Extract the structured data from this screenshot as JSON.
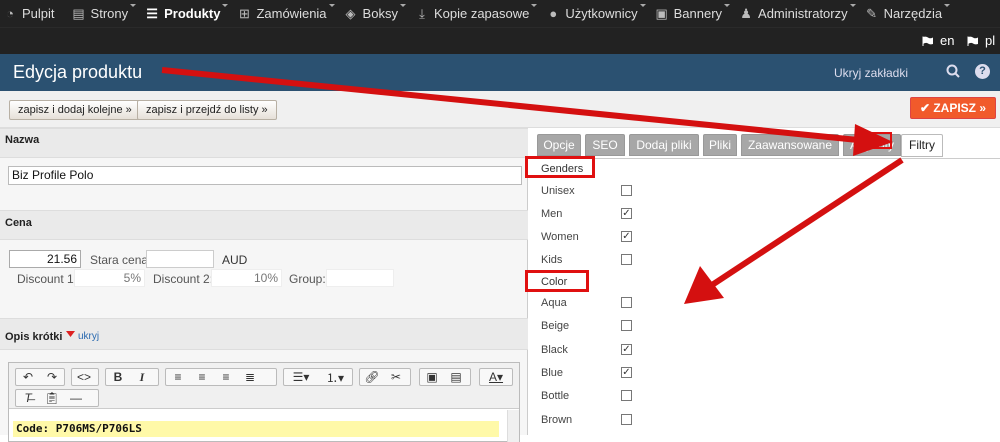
{
  "topnav": {
    "items": [
      {
        "label": "Pulpit",
        "icon": "gauge-icon",
        "active": false,
        "caret": false
      },
      {
        "label": "Strony",
        "icon": "page-icon",
        "active": false,
        "caret": true
      },
      {
        "label": "Produkty",
        "icon": "list-icon",
        "active": true,
        "caret": true
      },
      {
        "label": "Zamówienia",
        "icon": "cart-icon",
        "active": false,
        "caret": true
      },
      {
        "label": "Boksy",
        "icon": "cube-icon",
        "active": false,
        "caret": true
      },
      {
        "label": "Kopie zapasowe",
        "icon": "download-icon",
        "active": false,
        "caret": true
      },
      {
        "label": "Użytkownicy",
        "icon": "user-icon",
        "active": false,
        "caret": true
      },
      {
        "label": "Bannery",
        "icon": "image-icon",
        "active": false,
        "caret": true
      },
      {
        "label": "Administratorzy",
        "icon": "admin-icon",
        "active": false,
        "caret": true
      },
      {
        "label": "Narzędzia",
        "icon": "wrench-icon",
        "active": false,
        "caret": true
      }
    ]
  },
  "languages": [
    {
      "code": "en",
      "icon": "flag-icon"
    },
    {
      "code": "pl",
      "icon": "flag-icon"
    }
  ],
  "header": {
    "title": "Edycja produktu",
    "hide_tabs": "Ukryj zakładki",
    "help": "?"
  },
  "toolbar": {
    "save_add": "zapisz i dodaj kolejne »",
    "save_list": "zapisz i przejdź do listy »",
    "save": "ZAPISZ »"
  },
  "form": {
    "name_label": "Nazwa",
    "name_value": "Biz Profile Polo",
    "price_label": "Cena",
    "price_value": "21.56",
    "old_price_label": "Stara cena",
    "old_price_value": "",
    "currency": "AUD",
    "discount1_label": "Discount 1:",
    "discount1_value": "5%",
    "discount2_label": "Discount 2:",
    "discount2_value": "10%",
    "group_label": "Group:",
    "group_value": "",
    "short_desc_label": "Opis krótki",
    "hide_link": "ukryj"
  },
  "editor": {
    "content": "Code: P706MS/P706LS"
  },
  "tabs": [
    {
      "label": "Opcje",
      "active": false
    },
    {
      "label": "SEO",
      "active": false
    },
    {
      "label": "Dodaj pliki",
      "active": false
    },
    {
      "label": "Pliki",
      "active": false
    },
    {
      "label": "Zaawansowane",
      "active": false
    },
    {
      "label": "Atrybuty",
      "active": false
    },
    {
      "label": "Filtry",
      "active": true
    }
  ],
  "filters": {
    "groups": [
      {
        "title": "Genders",
        "items": [
          {
            "label": "Unisex",
            "checked": false
          },
          {
            "label": "Men",
            "checked": true
          },
          {
            "label": "Women",
            "checked": true
          },
          {
            "label": "Kids",
            "checked": false
          }
        ]
      },
      {
        "title": "Color",
        "items": [
          {
            "label": "Aqua",
            "checked": false
          },
          {
            "label": "Beige",
            "checked": false
          },
          {
            "label": "Black",
            "checked": true
          },
          {
            "label": "Blue",
            "checked": true
          },
          {
            "label": "Bottle",
            "checked": false
          },
          {
            "label": "Brown",
            "checked": false
          }
        ]
      }
    ]
  },
  "colors": {
    "accent": "#f15a2b",
    "header": "#2b5171",
    "annotation": "#e01010"
  }
}
